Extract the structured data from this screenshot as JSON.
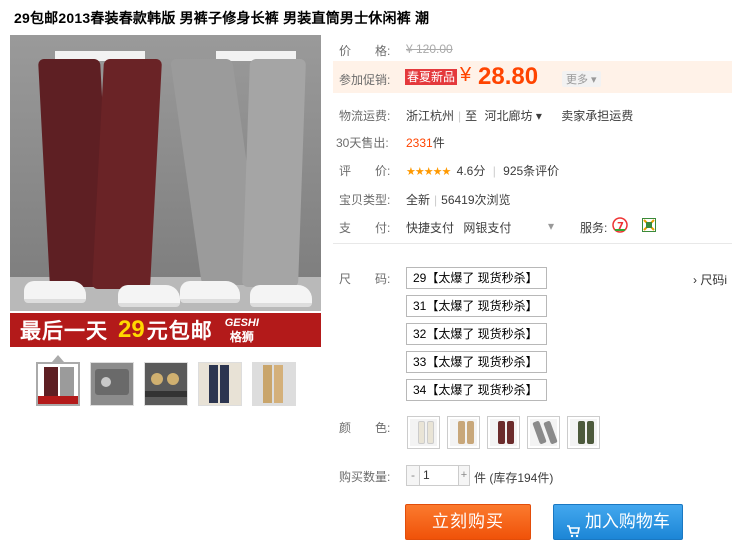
{
  "title": "29包邮2013春装春款韩版 男裤子修身长裤 男装直筒男士休闲裤 潮",
  "gallery": {
    "banner_text1": "最后一天",
    "banner_price": "29",
    "banner_text2": "元包邮",
    "brand_en": "GESHI",
    "brand_cn": "格狮"
  },
  "price": {
    "label": "价　　格:",
    "original": "¥ 120.00"
  },
  "promo": {
    "label": "参加促销:",
    "tag": "春夏新品",
    "currency": "¥",
    "value": "28.80",
    "more": "更多 ▾"
  },
  "shipping": {
    "label": "物流运费:",
    "from": "浙江杭州",
    "sep": "至",
    "to": "河北廊坊 ▾",
    "fee": "卖家承担运费"
  },
  "sales": {
    "label": "30天售出:",
    "count": "2331",
    "unit": "件"
  },
  "rating": {
    "label": "评　　价:",
    "stars": "★★★★★",
    "score": "4.6分",
    "reviews": "925条评价"
  },
  "item_type": {
    "label": "宝贝类型:",
    "type": "全新",
    "views": "56419次浏览"
  },
  "payment": {
    "label": "支　　付:",
    "method1": "快捷支付",
    "method2": "网银支付",
    "service_label": "服务:"
  },
  "sizes": {
    "label": "尺　　码:",
    "options": [
      "29【太爆了 现货秒杀】",
      "31【太爆了 现货秒杀】",
      "32【太爆了 现货秒杀】",
      "33【太爆了 现货秒杀】",
      "34【太爆了 现货秒杀】"
    ],
    "chart_link": "› 尺码i"
  },
  "colors": {
    "label": "颜　　色:",
    "swatches": [
      "#e9e4d6",
      "#c8a77a",
      "#6b2b2b",
      "#8a8a8a",
      "#4d5a3c"
    ]
  },
  "quantity": {
    "label": "购买数量:",
    "minus": "-",
    "value": "1",
    "plus": "+",
    "stock": "件 (库存194件)"
  },
  "actions": {
    "buy": "立刻购买",
    "cart": "加入购物车"
  }
}
